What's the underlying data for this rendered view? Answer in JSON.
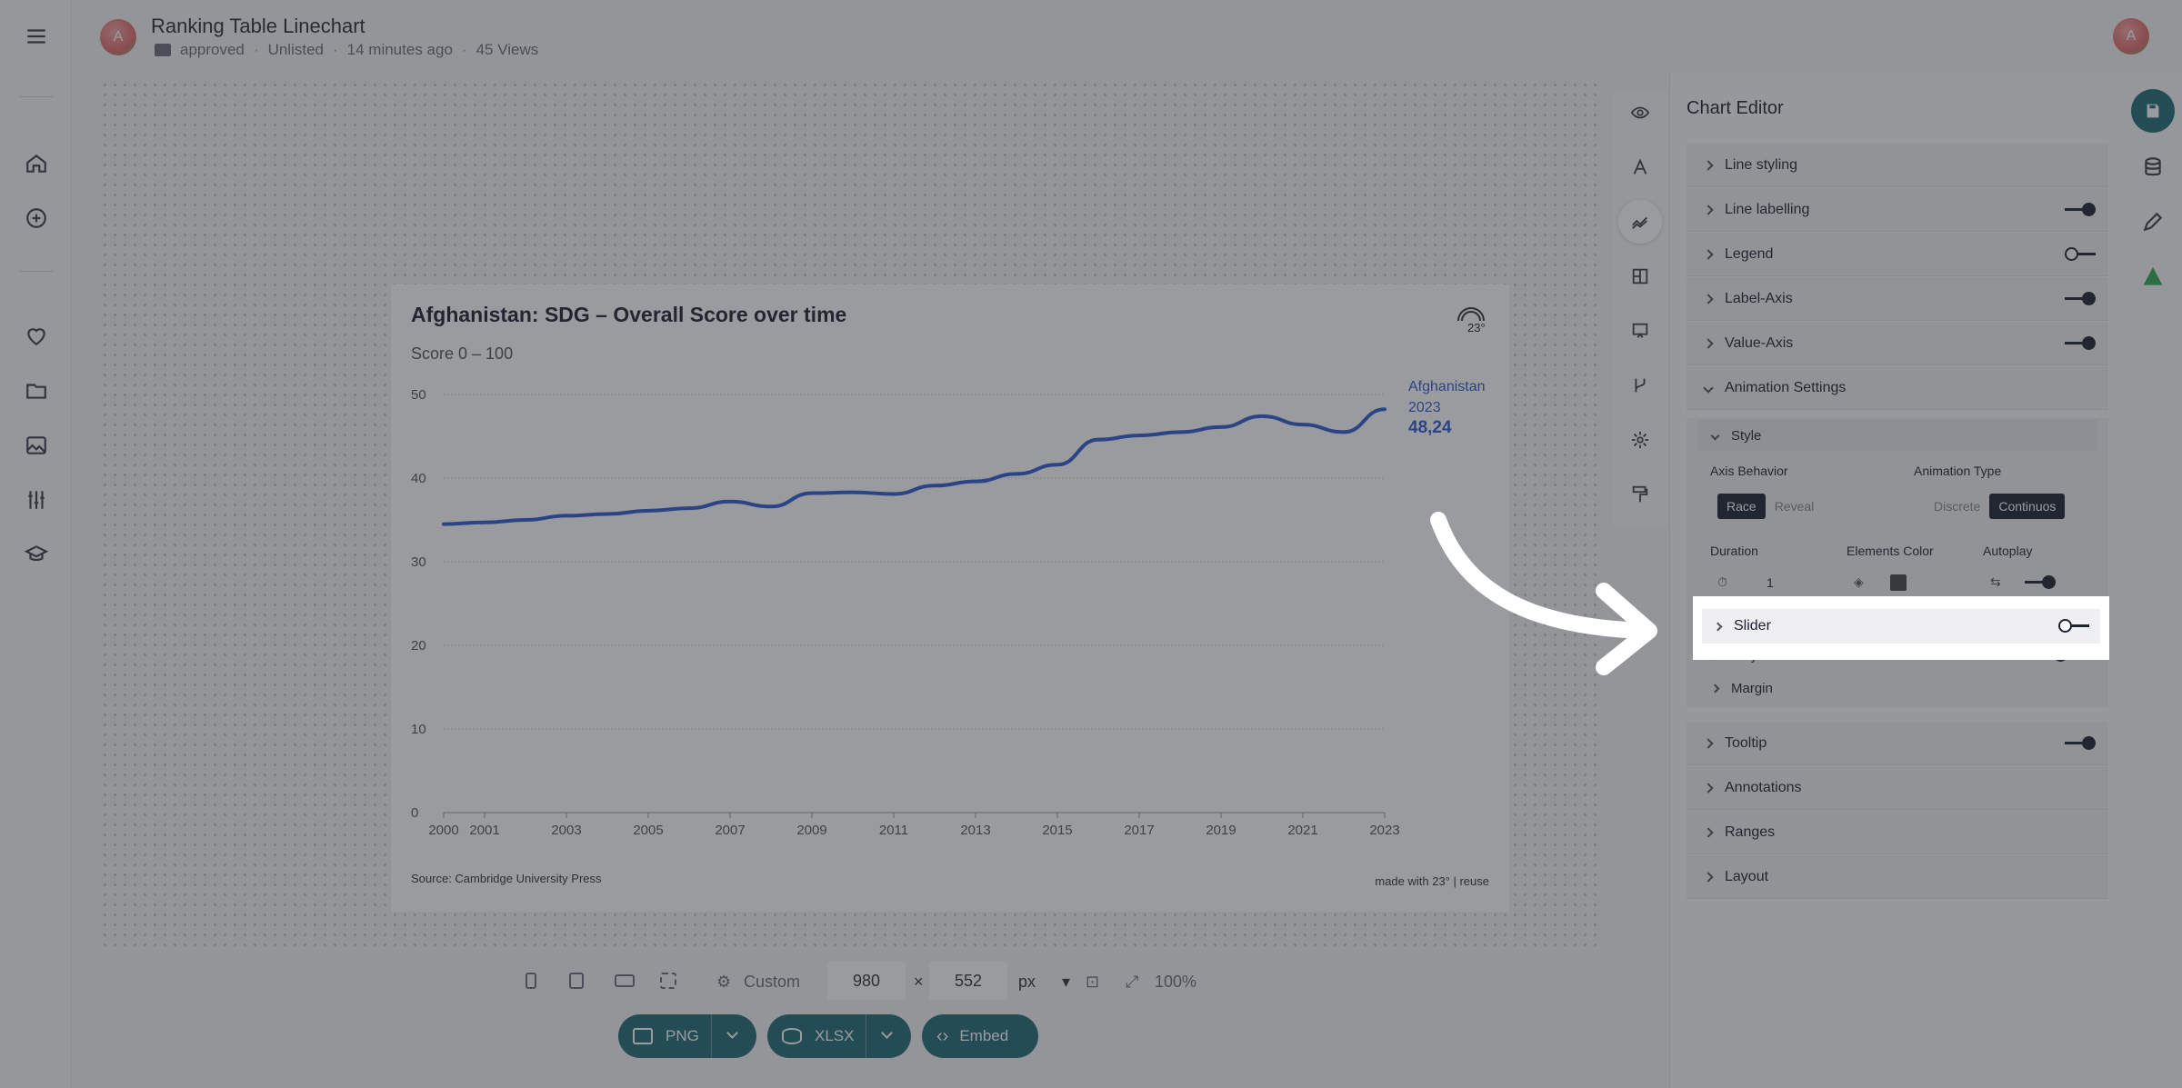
{
  "header": {
    "avatar_letter": "A",
    "title": "Ranking Table Linechart",
    "folder": "approved",
    "visibility": "Unlisted",
    "edited": "14 minutes ago",
    "views": "45 Views",
    "user_avatar_letter": "A"
  },
  "chart": {
    "title": "Afghanistan: SDG – Overall Score over time",
    "subtitle": "Score 0 – 100",
    "source": "Source: Cambridge University Press",
    "made_with": "made with 23° | reuse",
    "logo_text": "23°",
    "end_label_country": "Afghanistan",
    "end_label_year": "2023",
    "end_label_value": "48,24"
  },
  "chart_data": {
    "type": "line",
    "title": "Afghanistan: SDG – Overall Score over time",
    "subtitle": "Score 0 – 100",
    "ylim": [
      0,
      50
    ],
    "y_ticks": [
      0,
      10,
      20,
      30,
      40,
      50
    ],
    "x_tick_labels": [
      "2000",
      "2001",
      "2003",
      "2005",
      "2007",
      "2009",
      "2011",
      "2013",
      "2015",
      "2017",
      "2019",
      "2021",
      "2023"
    ],
    "grid": true,
    "series": [
      {
        "name": "Afghanistan",
        "color": "#2f5bd0",
        "x": [
          2000,
          2001,
          2002,
          2003,
          2004,
          2005,
          2006,
          2007,
          2008,
          2009,
          2010,
          2011,
          2012,
          2013,
          2014,
          2015,
          2016,
          2017,
          2018,
          2019,
          2020,
          2021,
          2022,
          2023
        ],
        "y": [
          34.5,
          34.7,
          35.0,
          35.5,
          35.7,
          36.1,
          36.4,
          37.2,
          36.6,
          38.2,
          38.3,
          38.1,
          39.1,
          39.6,
          40.5,
          41.6,
          44.6,
          45.1,
          45.5,
          46.1,
          47.4,
          46.4,
          45.5,
          48.24
        ]
      }
    ]
  },
  "tools": {
    "preview": "eye-icon",
    "text": "text-icon",
    "chart": "line-chart-icon",
    "layout": "layout-icon",
    "data": "presentation-icon",
    "branch": "branch-icon",
    "settings": "gear-icon",
    "brand": "paint-roller-icon"
  },
  "editor": {
    "title": "Chart Editor",
    "sections": {
      "line_styling": "Line styling",
      "line_labelling": "Line labelling",
      "legend": "Legend",
      "label_axis": "Label-Axis",
      "value_axis": "Value-Axis",
      "animation_settings": "Animation Settings",
      "tooltip": "Tooltip",
      "annotations": "Annotations",
      "ranges": "Ranges",
      "layout": "Layout"
    },
    "animation": {
      "style": "Style",
      "axis_behavior_label": "Axis Behavior",
      "axis_behavior_options": [
        "Race",
        "Reveal"
      ],
      "axis_behavior_selected": "Race",
      "animation_type_label": "Animation Type",
      "animation_type_options": [
        "Discrete",
        "Continuos"
      ],
      "animation_type_selected": "Continuos",
      "duration_label": "Duration",
      "duration_value": "1",
      "elements_color_label": "Elements Color",
      "autoplay_label": "Autoplay",
      "slider": "Slider",
      "playback": "Playback",
      "margin": "Margin"
    },
    "toggles": {
      "line_labelling": true,
      "legend": false,
      "label_axis": true,
      "value_axis": true,
      "autoplay": true,
      "slider": false,
      "playback": false,
      "tooltip": true
    }
  },
  "bottom": {
    "size_preset": "Custom",
    "width": "980",
    "times": "×",
    "height": "552",
    "unit": "px",
    "zoom": "100%",
    "png_button": "PNG",
    "xlsx_button": "XLSX",
    "embed_button": "Embed"
  },
  "colors": {
    "accent": "#1f6b74",
    "line": "#2f5bd0",
    "dark": "#1d2230"
  }
}
